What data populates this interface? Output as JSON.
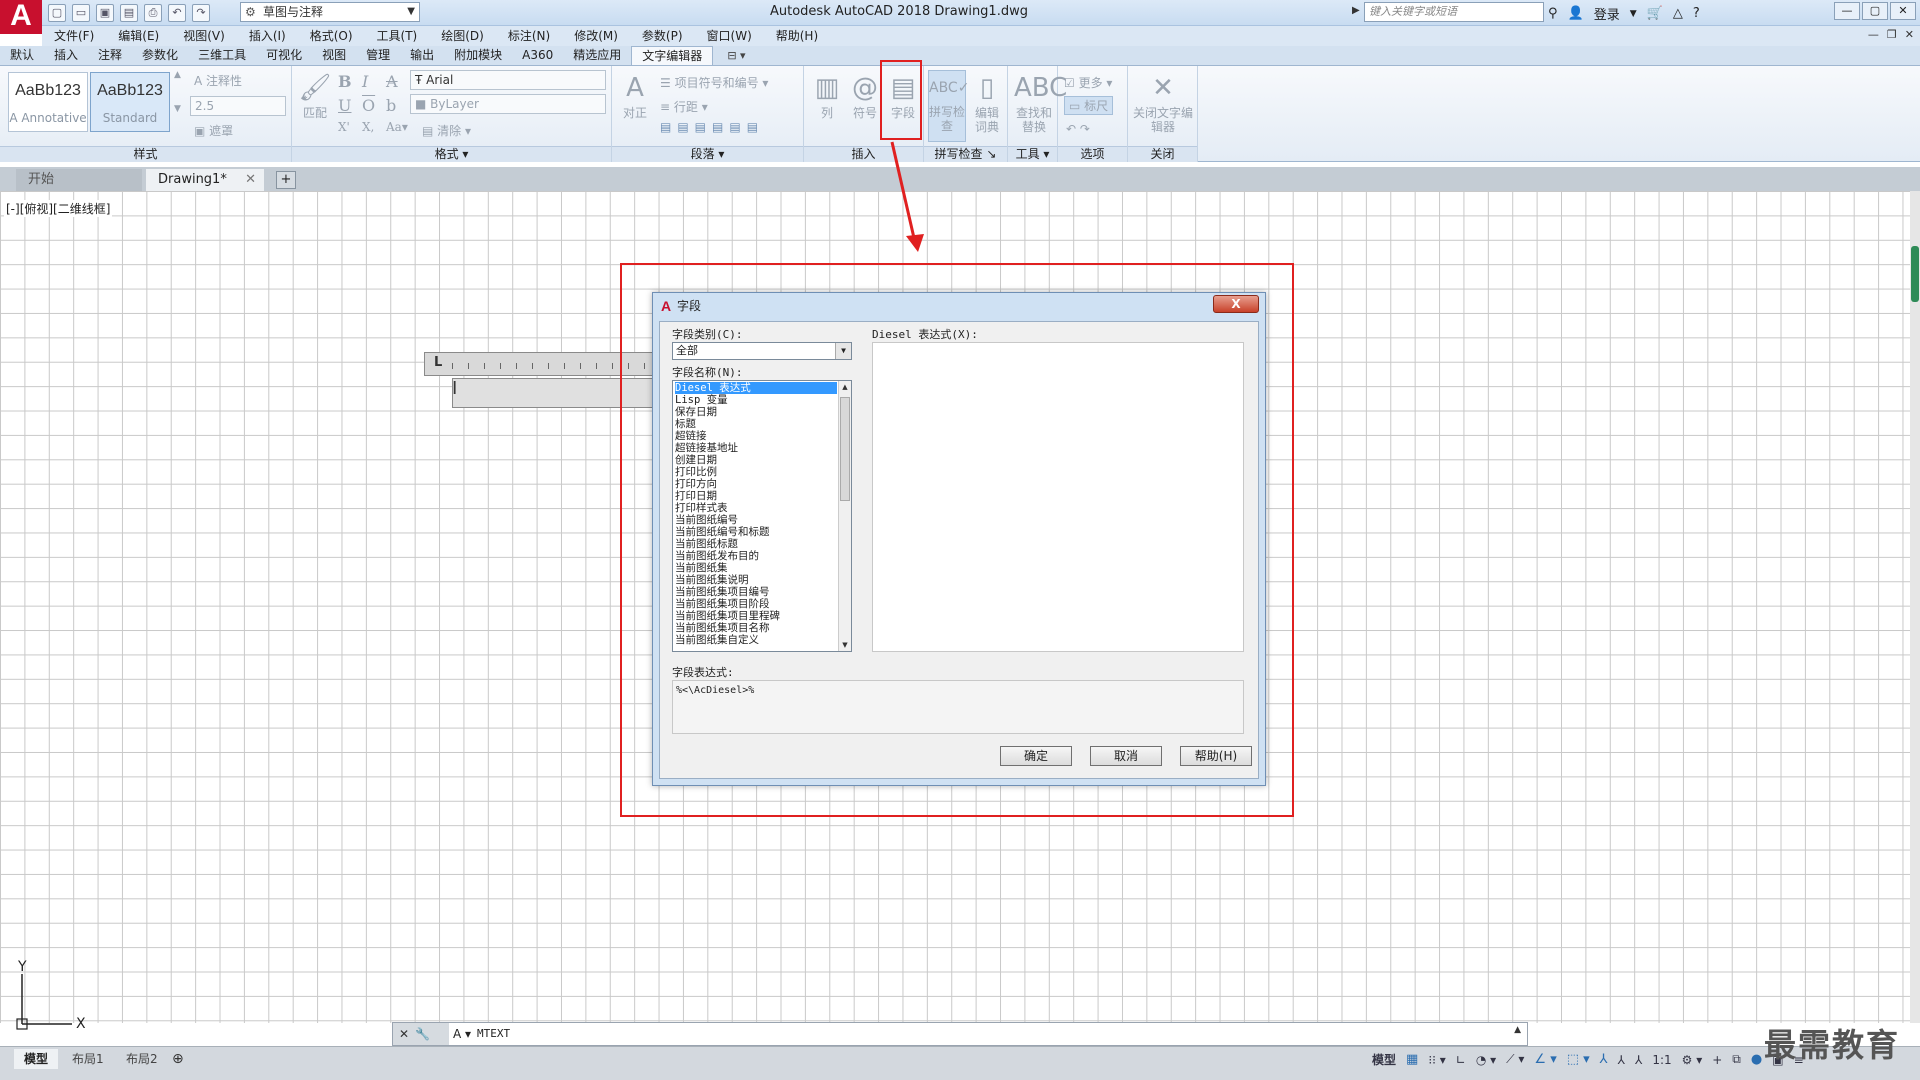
{
  "titlebar": {
    "app_logo": "A",
    "workspace": "草图与注释",
    "title": "Autodesk AutoCAD 2018    Drawing1.dwg",
    "search_placeholder": "键入关键字或短语",
    "login": "登录"
  },
  "menu": [
    "文件(F)",
    "编辑(E)",
    "视图(V)",
    "插入(I)",
    "格式(O)",
    "工具(T)",
    "绘图(D)",
    "标注(N)",
    "修改(M)",
    "参数(P)",
    "窗口(W)",
    "帮助(H)"
  ],
  "ribbon_tabs": [
    "默认",
    "插入",
    "注释",
    "参数化",
    "三维工具",
    "可视化",
    "视图",
    "管理",
    "输出",
    "附加模块",
    "A360",
    "精选应用",
    "文字编辑器"
  ],
  "ribbon": {
    "style_swatch_1": {
      "preview": "AaBb123",
      "name": "Annotative"
    },
    "style_swatch_2": {
      "preview": "AaBb123",
      "name": "Standard"
    },
    "annotative": "注释性",
    "height_value": "2.5",
    "mask": "遮罩",
    "match": "匹配",
    "font": "Arial",
    "color": "ByLayer",
    "clear": "清除",
    "justify": "对正",
    "bullets": "项目符号和编号",
    "line_spacing": "行距",
    "columns": "列",
    "symbol": "符号",
    "field": "字段",
    "spell_check": "拼写检查",
    "edit_dict": "编辑词典",
    "find_replace": "查找和替换",
    "more": "更多",
    "ruler": "标尺",
    "close_editor": "关闭文字编辑器",
    "panel_titles": {
      "style": "样式",
      "format": "格式",
      "paragraph": "段落",
      "insert": "插入",
      "spell": "拼写检查",
      "tools": "工具",
      "options": "选项",
      "close": "关闭"
    }
  },
  "filetabs": {
    "start": "开始",
    "drawing": "Drawing1*"
  },
  "view_label": "[-][俯视][二维线框]",
  "dialog": {
    "title": "字段",
    "close": "X",
    "category_label": "字段类别(C):",
    "category_value": "全部",
    "names_label": "字段名称(N):",
    "names": [
      "Diesel 表达式",
      "Lisp 变量",
      "保存日期",
      "标题",
      "超链接",
      "超链接基地址",
      "创建日期",
      "打印比例",
      "打印方向",
      "打印日期",
      "打印样式表",
      "当前图纸编号",
      "当前图纸编号和标题",
      "当前图纸标题",
      "当前图纸发布目的",
      "当前图纸集",
      "当前图纸集说明",
      "当前图纸集项目编号",
      "当前图纸集项目阶段",
      "当前图纸集项目里程碑",
      "当前图纸集项目名称",
      "当前图纸集自定义"
    ],
    "diesel_label": "Diesel 表达式(X):",
    "expr_label": "字段表达式:",
    "expr_value": "%<\\AcDiesel>%",
    "ok": "确定",
    "cancel": "取消",
    "help": "帮助(H)"
  },
  "command": {
    "prompt": "MTEXT"
  },
  "status": {
    "model_tab": "模型",
    "layout1": "布局1",
    "layout2": "布局2",
    "model": "模型",
    "scale": "1:1"
  },
  "watermark": "最需教育",
  "ucs": {
    "x": "X",
    "y": "Y"
  },
  "colors": {
    "highlight": "#e02020",
    "accent": "#3399ff"
  }
}
